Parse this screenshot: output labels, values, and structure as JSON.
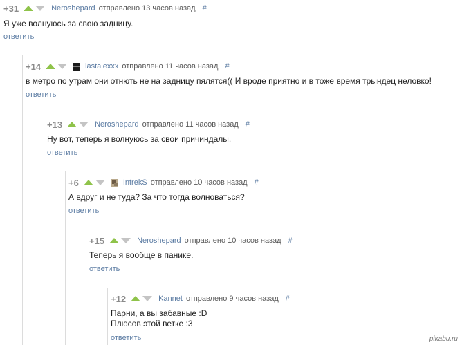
{
  "comments": [
    {
      "rating": "+31",
      "user": "Neroshepard",
      "time": "отправлено 13 часов назад",
      "hash": "#",
      "lines": [
        "Я уже волнуюсь за свою задницу."
      ],
      "reply": "ответить"
    },
    {
      "rating": "+14",
      "user": "lastalexxx",
      "time": "отправлено 11 часов назад",
      "hash": "#",
      "lines": [
        "в метро по утрам они отнють не на задницу пялятся(( И вроде приятно и в тоже время трындец неловко!"
      ],
      "reply": "ответить"
    },
    {
      "rating": "+13",
      "user": "Neroshepard",
      "time": "отправлено 11 часов назад",
      "hash": "#",
      "lines": [
        "Ну вот, теперь я волнуюсь за свои причиндалы."
      ],
      "reply": "ответить"
    },
    {
      "rating": "+6",
      "user": "IntrekS",
      "time": "отправлено 10 часов назад",
      "hash": "#",
      "lines": [
        "А вдруг и не туда? За что тогда волноваться?"
      ],
      "reply": "ответить"
    },
    {
      "rating": "+15",
      "user": "Neroshepard",
      "time": "отправлено 10 часов назад",
      "hash": "#",
      "lines": [
        "Теперь я вообще в панике."
      ],
      "reply": "ответить"
    },
    {
      "rating": "+12",
      "user": "Kannet",
      "time": "отправлено 9 часов назад",
      "hash": "#",
      "lines": [
        "Парни, а вы забавные :D",
        "Плюсов этой ветке :3"
      ],
      "reply": "ответить"
    }
  ],
  "watermark": "pikabu.ru",
  "colors": {
    "upvote": "#8fc34a",
    "downvote": "#c4c4c4",
    "link": "#5c7ca3",
    "thread_line": "#dcdcdc"
  }
}
